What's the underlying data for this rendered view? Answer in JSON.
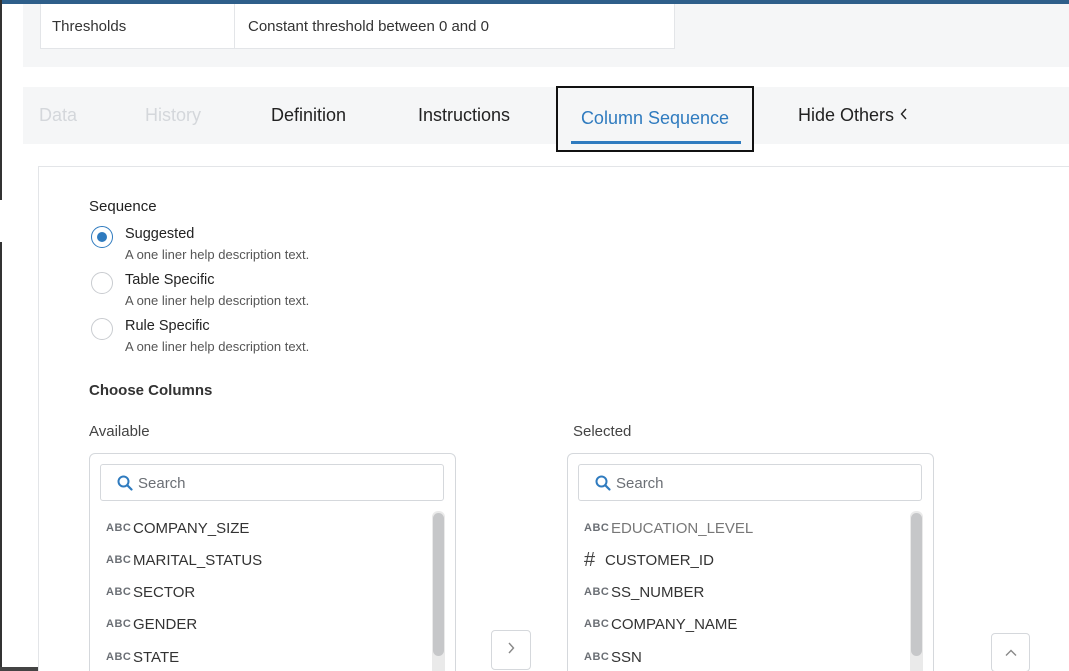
{
  "thresholds": {
    "label": "Thresholds",
    "value": "Constant threshold between 0 and 0"
  },
  "tabs": [
    {
      "label": "Data",
      "state": "faded"
    },
    {
      "label": "History",
      "state": "faded"
    },
    {
      "label": "Definition",
      "state": "normal"
    },
    {
      "label": "Instructions",
      "state": "normal"
    },
    {
      "label": "Column Sequence",
      "state": "active"
    },
    {
      "label": "Hide Others",
      "state": "normal"
    }
  ],
  "sequence": {
    "label": "Sequence",
    "selected": "Suggested",
    "options": [
      {
        "title": "Suggested",
        "description": "A one liner help description text."
      },
      {
        "title": "Table Specific",
        "description": "A one liner help description text."
      },
      {
        "title": "Rule Specific",
        "description": "A one liner help description text."
      }
    ]
  },
  "choose_columns": {
    "label": "Choose Columns",
    "available": {
      "title": "Available",
      "search_placeholder": "Search",
      "items": [
        {
          "type": "ABC",
          "name": "COMPANY_SIZE"
        },
        {
          "type": "ABC",
          "name": "MARITAL_STATUS"
        },
        {
          "type": "ABC",
          "name": "SECTOR"
        },
        {
          "type": "ABC",
          "name": "GENDER"
        },
        {
          "type": "ABC",
          "name": "STATE"
        }
      ]
    },
    "selected": {
      "title": "Selected",
      "search_placeholder": "Search",
      "items": [
        {
          "type": "ABC",
          "name": "EDUCATION_LEVEL"
        },
        {
          "type": "#",
          "name": "CUSTOMER_ID"
        },
        {
          "type": "ABC",
          "name": "SS_NUMBER"
        },
        {
          "type": "ABC",
          "name": "COMPANY_NAME"
        },
        {
          "type": "ABC",
          "name": "SSN"
        }
      ]
    }
  },
  "icons": {
    "search": "search-icon",
    "move_right": "chevron-right-icon",
    "scroll_top": "chevron-up-icon",
    "hide_others": "chevron-left-icon",
    "string_type": "abc-type-icon",
    "number_type": "hash-type-icon"
  },
  "colors": {
    "accent": "#2f7bbf",
    "top_bar": "#2e5f8a",
    "panel_bg": "#f5f6f7"
  }
}
